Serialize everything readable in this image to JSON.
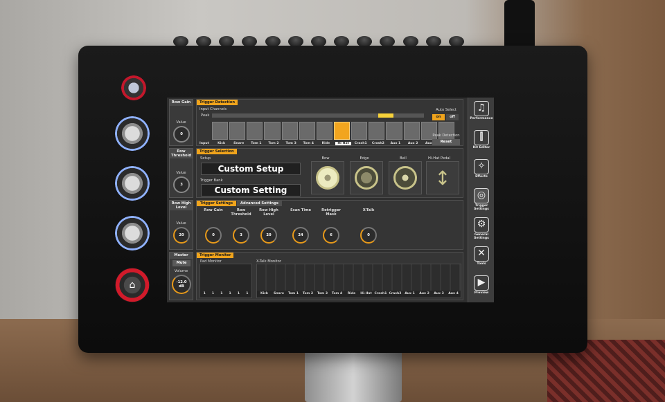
{
  "rows": [
    {
      "header": "Row Gain",
      "value_label": "Value",
      "value": "0"
    },
    {
      "header": "Row Threshold",
      "value_label": "Value",
      "value": "3"
    },
    {
      "header": "Row High Level",
      "value_label": "Value",
      "value": "20"
    }
  ],
  "master": {
    "header": "Master",
    "mute": "Mute",
    "volume_label": "Volume",
    "volume_value": "-12.0",
    "volume_unit": "dB"
  },
  "trigger_detection": {
    "title": "Trigger Detection",
    "input_channels": "Input Channels",
    "peak": "Peak",
    "input_label": "Input",
    "channels": [
      "Kick",
      "Snare",
      "Tom 1",
      "Tom 2",
      "Tom 3",
      "Tom 4",
      "Ride",
      "Hi-Hat",
      "Crash1",
      "Crash2",
      "Aux 1",
      "Aux 2",
      "Aux 3",
      "Aux 4"
    ],
    "selected_channel": 7,
    "auto_select": "Auto Select",
    "on": "on",
    "off": "off",
    "peak_detection": "Peak Detection",
    "reset": "Reset"
  },
  "trigger_selection": {
    "title": "Trigger Selection",
    "setup_label": "Setup",
    "setup_value": "Custom Setup",
    "trigger_bank_label": "Trigger Bank",
    "trigger_bank_value": "Custom Setting",
    "zones": [
      "Bow",
      "Edge",
      "Bell",
      "Hi-Hat Pedal"
    ]
  },
  "trigger_settings": {
    "tab_active": "Trigger Settings",
    "tab_inactive": "Advanced Settings",
    "knobs": [
      {
        "label": "Row Gain",
        "value": "0"
      },
      {
        "label": "Row Threshold",
        "value": "3"
      },
      {
        "label": "Row High Level",
        "value": "20"
      },
      {
        "label": "Scan Time",
        "value": "24"
      },
      {
        "label": "Retrigger Mask",
        "value": "6"
      },
      {
        "label": "X-Talk",
        "value": "0"
      }
    ]
  },
  "trigger_monitor": {
    "title": "Trigger Monitor",
    "pad_monitor": "Pad Monitor",
    "xtalk_monitor": "X-Talk Monitor",
    "pad_values": [
      "1",
      "1",
      "1",
      "1",
      "1",
      "1"
    ],
    "monitor_channels": [
      "Kick",
      "Snare",
      "Tom 1",
      "Tom 2",
      "Tom 3",
      "Tom 4",
      "Ride",
      "Hi-Hat",
      "Crash1",
      "Crash2",
      "Aux 1",
      "Aux 2",
      "Aux 3",
      "Aux 4"
    ]
  },
  "sidebar": [
    {
      "label": "Performance",
      "icon": "music-note-icon",
      "glyph": "♫"
    },
    {
      "label": "Kit Editor",
      "icon": "sliders-icon",
      "glyph": "⫿"
    },
    {
      "label": "Effects",
      "icon": "magic-wand-icon",
      "glyph": "✧"
    },
    {
      "label": "Trigger Settings",
      "icon": "trigger-icon",
      "glyph": "◎"
    },
    {
      "label": "General Settings",
      "icon": "gear-icon",
      "glyph": "⚙"
    },
    {
      "label": "Tools",
      "icon": "tools-icon",
      "glyph": "✕"
    },
    {
      "label": "Preview",
      "icon": "play-icon",
      "glyph": "▶"
    }
  ],
  "colors": {
    "accent": "#f0a41c",
    "screen_bg": "#2f2f2f"
  }
}
